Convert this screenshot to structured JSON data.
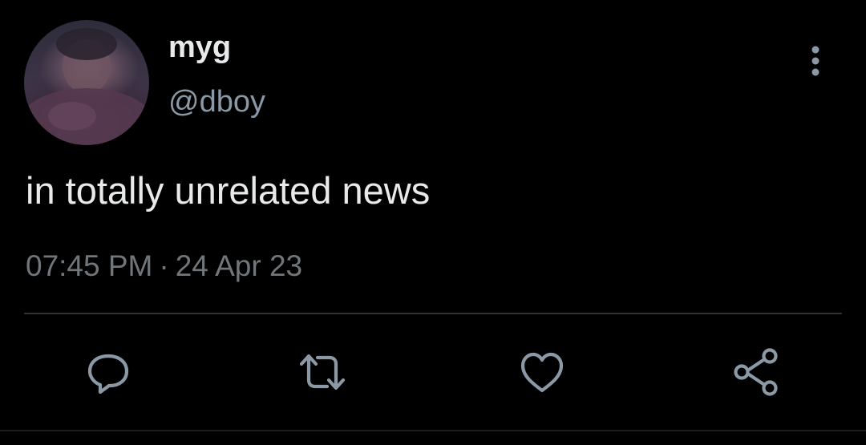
{
  "user": {
    "display_name": "myg",
    "handle": "@dboy"
  },
  "tweet": {
    "text": "in totally unrelated news",
    "time": "07:45 PM",
    "separator": "·",
    "date": "24 Apr 23"
  },
  "actions": {
    "icons": [
      "reply-icon",
      "retweet-icon",
      "like-icon",
      "share-icon"
    ]
  },
  "colors": {
    "background": "#000000",
    "primary_text": "#e7e9ea",
    "secondary_text": "#8b98a5",
    "icon": "#8b98a5",
    "divider": "#2f3336"
  }
}
